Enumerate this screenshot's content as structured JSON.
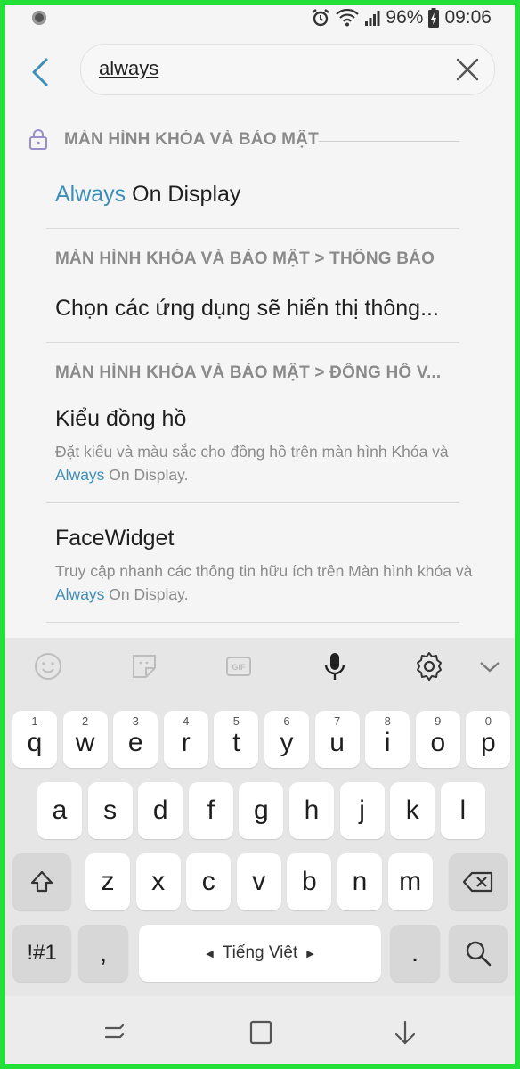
{
  "status_bar": {
    "battery": "96%",
    "time": "09:06"
  },
  "search": {
    "query": "always"
  },
  "results": {
    "section1": {
      "header": "MÀN HÌNH KHÓA VÀ BẢO MẬT"
    },
    "item1": {
      "title_hl": "Always",
      "title_rest": " On Display"
    },
    "section2": {
      "header": "MÀN HÌNH KHÓA VÀ BẢO MẬT > THÔNG BÁO"
    },
    "item2": {
      "title": "Chọn các ứng dụng sẽ hiển thị thông..."
    },
    "section3": {
      "header": "MÀN HÌNH KHÓA VÀ BẢO MẬT > ĐỒNG HỒ V..."
    },
    "item3": {
      "title": "Kiểu đồng hồ",
      "desc_a": "Đặt kiểu và màu sắc cho đồng hồ trên màn hình Khóa và ",
      "desc_hl": "Always",
      "desc_b": " On Display."
    },
    "item4": {
      "title": "FaceWidget",
      "desc_a": "Truy cập nhanh các thông tin hữu ích trên Màn hình khóa và ",
      "desc_hl": "Always",
      "desc_b": " On Display."
    }
  },
  "keyboard": {
    "row1": [
      {
        "ch": "q",
        "num": "1"
      },
      {
        "ch": "w",
        "num": "2"
      },
      {
        "ch": "e",
        "num": "3"
      },
      {
        "ch": "r",
        "num": "4"
      },
      {
        "ch": "t",
        "num": "5"
      },
      {
        "ch": "y",
        "num": "6"
      },
      {
        "ch": "u",
        "num": "7"
      },
      {
        "ch": "i",
        "num": "8"
      },
      {
        "ch": "o",
        "num": "9"
      },
      {
        "ch": "p",
        "num": "0"
      }
    ],
    "row2": [
      "a",
      "s",
      "d",
      "f",
      "g",
      "h",
      "j",
      "k",
      "l"
    ],
    "row3": [
      "z",
      "x",
      "c",
      "v",
      "b",
      "n",
      "m"
    ],
    "symbols_label": "!#1",
    "comma_label": ",",
    "space_label": "Tiếng Việt",
    "period_label": "."
  },
  "colors": {
    "highlight": "#3d8fb8",
    "accent_back": "#3d8fb8"
  }
}
